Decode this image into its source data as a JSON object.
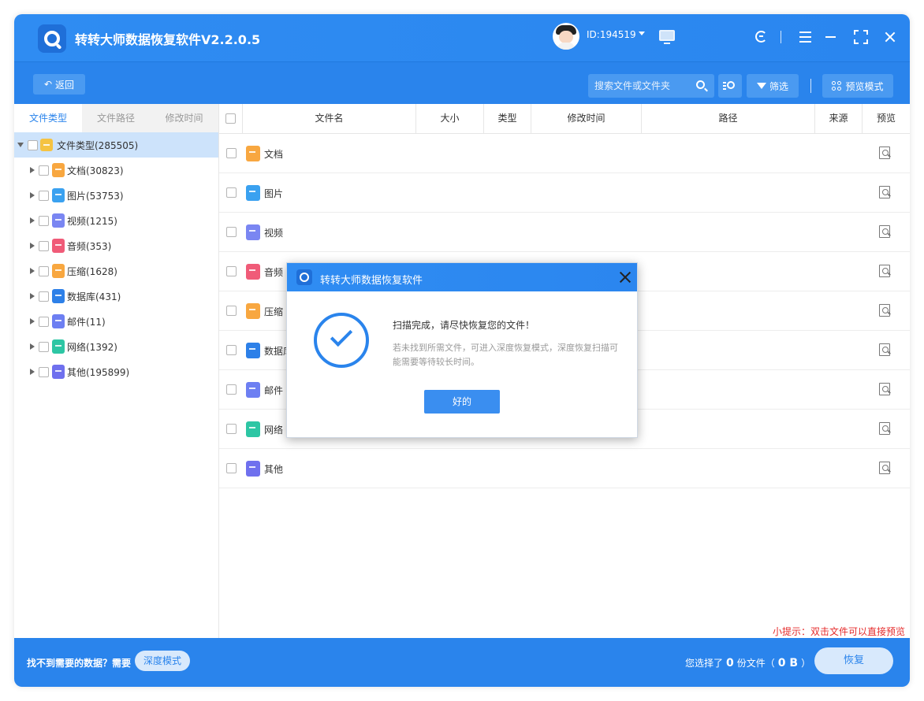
{
  "app": {
    "title": "转转大师数据恢复软件V2.2.0.5",
    "user_id": "ID:194519"
  },
  "toolbar": {
    "back_label": "返回",
    "search_placeholder": "搜索文件或文件夹",
    "filter_label": "筛选",
    "preview_mode_label": "预览模式"
  },
  "left_tabs": [
    "文件类型",
    "文件路径",
    "修改时间"
  ],
  "tree": {
    "root": "文件类型(285505)",
    "items": [
      {
        "label": "文档(30823)",
        "icon": "doc"
      },
      {
        "label": "图片(53753)",
        "icon": "img"
      },
      {
        "label": "视频(1215)",
        "icon": "vid"
      },
      {
        "label": "音频(353)",
        "icon": "aud"
      },
      {
        "label": "压缩(1628)",
        "icon": "zip"
      },
      {
        "label": "数据库(431)",
        "icon": "db"
      },
      {
        "label": "邮件(11)",
        "icon": "mail"
      },
      {
        "label": "网络(1392)",
        "icon": "net"
      },
      {
        "label": "其他(195899)",
        "icon": "oth"
      }
    ]
  },
  "table": {
    "columns": [
      "文件名",
      "大小",
      "类型",
      "修改时间",
      "路径",
      "来源",
      "预览"
    ],
    "rows": [
      {
        "name": "文档",
        "icon": "doc"
      },
      {
        "name": "图片",
        "icon": "img"
      },
      {
        "name": "视频",
        "icon": "vid"
      },
      {
        "name": "音频",
        "icon": "aud"
      },
      {
        "name": "压缩",
        "icon": "zip"
      },
      {
        "name": "数据库",
        "icon": "db"
      },
      {
        "name": "邮件",
        "icon": "mail"
      },
      {
        "name": "网络",
        "icon": "net"
      },
      {
        "name": "其他",
        "icon": "oth"
      }
    ]
  },
  "tip": "小提示：双击文件可以直接预览",
  "footer": {
    "question": "找不到需要的数据？需要",
    "deep_mode": "深度模式",
    "sel_prefix": "您选择了",
    "sel_count": "0",
    "sel_mid": "份文件（",
    "sel_size": "0 B",
    "sel_suffix": "）",
    "recover": "恢复"
  },
  "dialog": {
    "title": "转转大师数据恢复软件",
    "message": "扫描完成，请尽快恢复您的文件！",
    "sub": "若未找到所需文件，可进入深度恢复模式，深度恢复扫描可能需要等待较长时间。",
    "ok": "好的"
  },
  "colors": {
    "primary": "#2a84ec",
    "tip": "#e52b2b",
    "selected_row": "#cde3fb"
  }
}
